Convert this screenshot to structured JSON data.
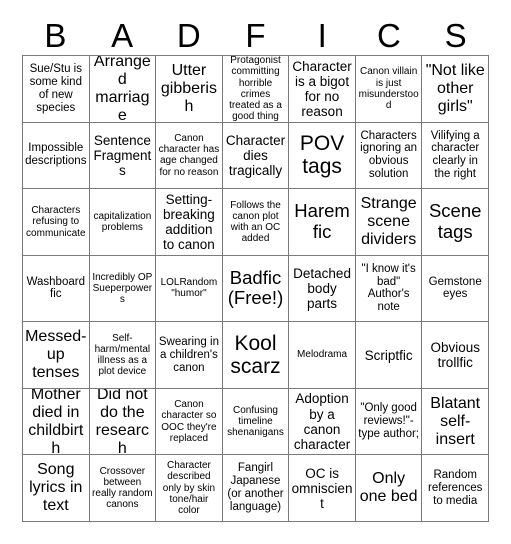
{
  "card": {
    "title_letters": [
      "B",
      "A",
      "D",
      "F",
      "I",
      "C",
      "S"
    ],
    "grid_size": "7x7",
    "border_color": "#7a7a7a",
    "background_color": "#ffffff",
    "text_color": "#000000",
    "free_space_index": 24
  },
  "cells": [
    {
      "text": "Sue/Stu is some kind of new species",
      "size": "sm"
    },
    {
      "text": "Arranged marriage",
      "size": "lg"
    },
    {
      "text": "Utter gibberish",
      "size": "lg"
    },
    {
      "text": "Protagonist committing horrible crimes treated as a good thing",
      "size": "xs"
    },
    {
      "text": "Character is a bigot for no reason",
      "size": "md"
    },
    {
      "text": "Canon villain is just misunderstood",
      "size": "xs"
    },
    {
      "text": "\"Not like other girls\"",
      "size": "lg"
    },
    {
      "text": "Impossible descriptions",
      "size": "sm"
    },
    {
      "text": "Sentence Fragments",
      "size": "md"
    },
    {
      "text": "Canon character has age changed for no reason",
      "size": "xs"
    },
    {
      "text": "Character dies tragically",
      "size": "md"
    },
    {
      "text": "POV tags",
      "size": "xxl"
    },
    {
      "text": "Characters ignoring an obvious solution",
      "size": "sm"
    },
    {
      "text": "Vilifying a character clearly in the right",
      "size": "sm"
    },
    {
      "text": "Characters refusing to communicate",
      "size": "xs"
    },
    {
      "text": "capitalization problems",
      "size": "xs"
    },
    {
      "text": "Setting-breaking addition to canon",
      "size": "md"
    },
    {
      "text": "Follows the canon plot with an OC added",
      "size": "xs"
    },
    {
      "text": "Harem fic",
      "size": "xl"
    },
    {
      "text": "Strange scene dividers",
      "size": "lg"
    },
    {
      "text": "Scene tags",
      "size": "xl"
    },
    {
      "text": "Washboard fic",
      "size": "sm"
    },
    {
      "text": "Incredibly OP Sueperpowers",
      "size": "xs"
    },
    {
      "text": "LOLRandom \"humor\"",
      "size": "xs"
    },
    {
      "text": "Badfic (Free!)",
      "size": "xl"
    },
    {
      "text": "Detached body parts",
      "size": "md"
    },
    {
      "text": "\"I know it's bad\" Author's note",
      "size": "sm"
    },
    {
      "text": "Gemstone eyes",
      "size": "sm"
    },
    {
      "text": "Messed-up tenses",
      "size": "lg"
    },
    {
      "text": "Self-harm/mental illness as a plot device",
      "size": "xs"
    },
    {
      "text": "Swearing in a children's canon",
      "size": "sm"
    },
    {
      "text": "Kool scarz",
      "size": "xxl"
    },
    {
      "text": "Melodrama",
      "size": "xs"
    },
    {
      "text": "Scriptfic",
      "size": "md"
    },
    {
      "text": "Obvious trollfic",
      "size": "md"
    },
    {
      "text": "Mother died in childbirth",
      "size": "lg"
    },
    {
      "text": "Did not do the research",
      "size": "lg"
    },
    {
      "text": "Canon character so OOC they're replaced",
      "size": "xs"
    },
    {
      "text": "Confusing timeline shenanigans",
      "size": "xs"
    },
    {
      "text": "Adoption by a canon character",
      "size": "md"
    },
    {
      "text": "\"Only good reviews!\"-type author;",
      "size": "sm"
    },
    {
      "text": "Blatant self-insert",
      "size": "lg"
    },
    {
      "text": "Song lyrics in text",
      "size": "lg"
    },
    {
      "text": "Crossover between really random canons",
      "size": "xs"
    },
    {
      "text": "Character described only by skin tone/hair color",
      "size": "xs"
    },
    {
      "text": "Fangirl Japanese (or another language)",
      "size": "sm"
    },
    {
      "text": "OC is omniscient",
      "size": "md"
    },
    {
      "text": "Only one bed",
      "size": "lg"
    },
    {
      "text": "Random references to media",
      "size": "sm"
    }
  ]
}
